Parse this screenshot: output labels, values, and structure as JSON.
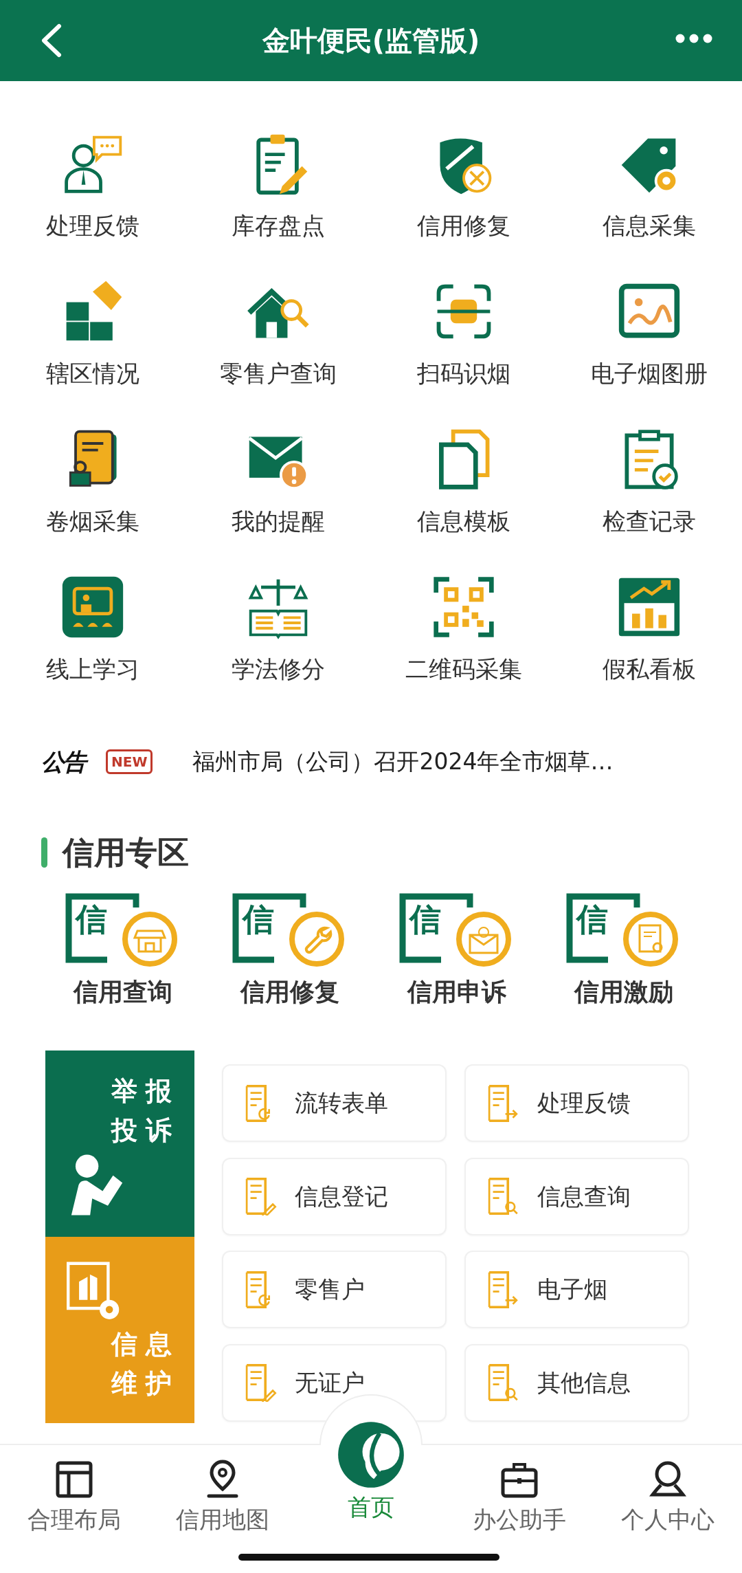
{
  "header": {
    "title": "金叶便民(监管版)"
  },
  "features": [
    {
      "label": "处理反馈"
    },
    {
      "label": "库存盘点"
    },
    {
      "label": "信用修复"
    },
    {
      "label": "信息采集"
    },
    {
      "label": "辖区情况"
    },
    {
      "label": "零售户查询"
    },
    {
      "label": "扫码识烟"
    },
    {
      "label": "电子烟图册"
    },
    {
      "label": "卷烟采集"
    },
    {
      "label": "我的提醒"
    },
    {
      "label": "信息模板"
    },
    {
      "label": "检查记录"
    },
    {
      "label": "线上学习"
    },
    {
      "label": "学法修分"
    },
    {
      "label": "二维码采集"
    },
    {
      "label": "假私看板"
    }
  ],
  "notice": {
    "tag": "公告",
    "badge": "NEW",
    "text": "福州市局（公司）召开2024年全市烟草…"
  },
  "credit_zone": {
    "title": "信用专区",
    "items": [
      {
        "badge": "信",
        "label": "信用查询"
      },
      {
        "badge": "信",
        "label": "信用修复"
      },
      {
        "badge": "信",
        "label": "信用申诉"
      },
      {
        "badge": "信",
        "label": "信用激励"
      }
    ]
  },
  "side_panels": [
    {
      "kind": "report",
      "label": "举报投诉"
    },
    {
      "kind": "maintain",
      "label": "信息维护"
    }
  ],
  "quick_links": [
    {
      "label": "流转表单"
    },
    {
      "label": "处理反馈"
    },
    {
      "label": "信息登记"
    },
    {
      "label": "信息查询"
    },
    {
      "label": "零售户"
    },
    {
      "label": "电子烟"
    },
    {
      "label": "无证户"
    },
    {
      "label": "其他信息"
    }
  ],
  "bottom_nav": [
    {
      "label": "合理布局",
      "selected": false
    },
    {
      "label": "信用地图",
      "selected": false
    },
    {
      "label": "首页",
      "selected": true
    },
    {
      "label": "办公助手",
      "selected": false
    },
    {
      "label": "个人中心",
      "selected": false
    }
  ]
}
